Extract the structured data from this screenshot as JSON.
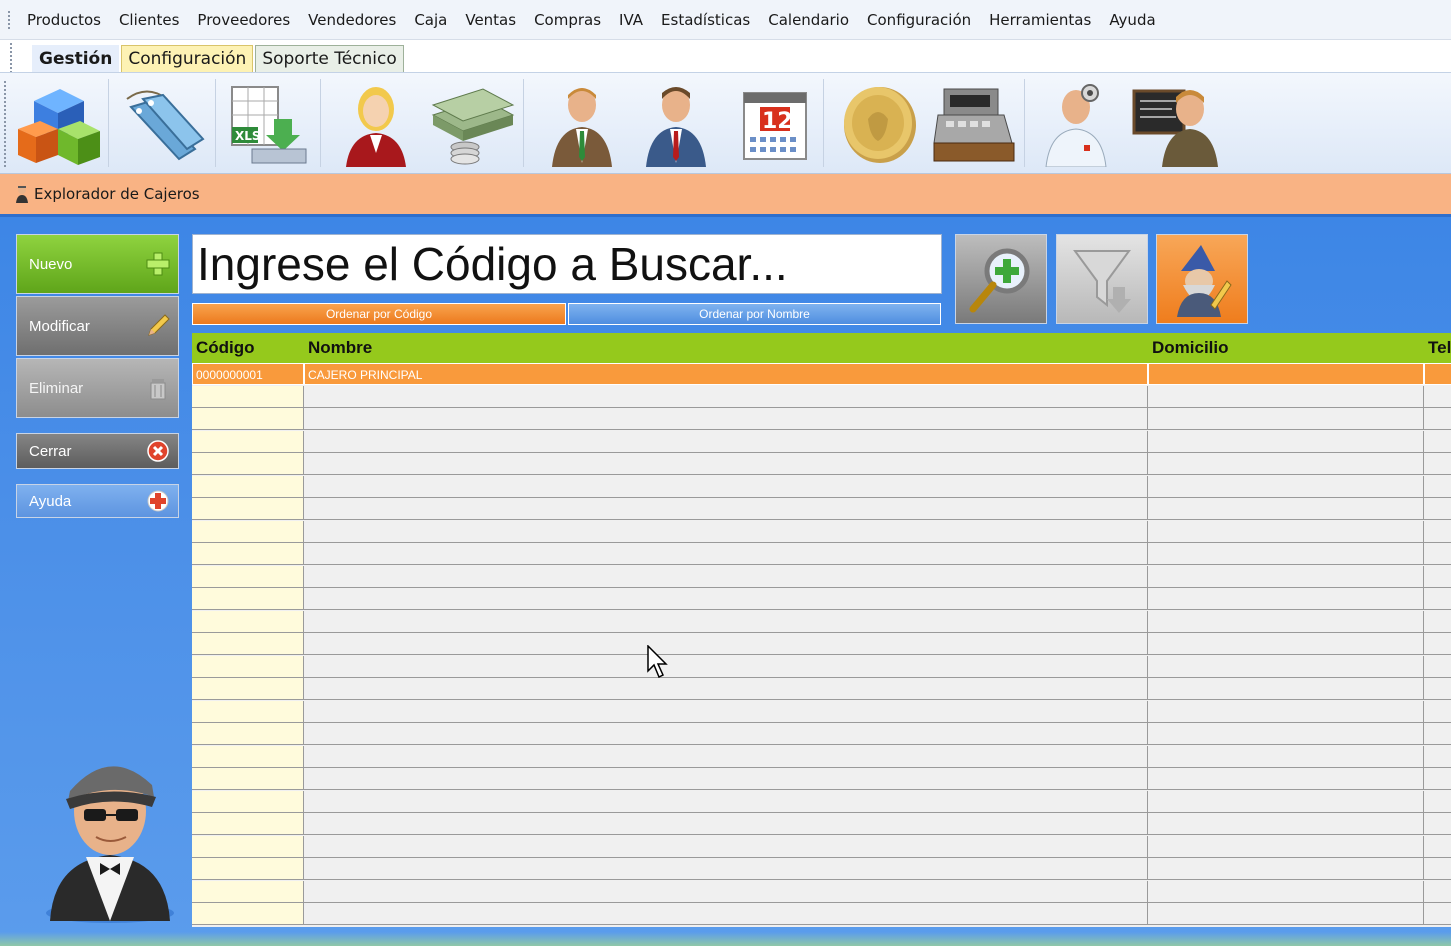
{
  "menu": {
    "items": [
      "Productos",
      "Clientes",
      "Proveedores",
      "Vendedores",
      "Caja",
      "Ventas",
      "Compras",
      "IVA",
      "Estadísticas",
      "Calendario",
      "Configuración",
      "Herramientas",
      "Ayuda"
    ]
  },
  "ribbon": {
    "tabs": [
      "Gestión",
      "Configuración",
      "Soporte Técnico"
    ],
    "active_tab": "Gestión",
    "icons": [
      "products-cubes-icon",
      "price-tags-icon",
      "xls-import-icon",
      "seller-woman-icon",
      "money-stack-icon",
      "client-man-icon",
      "supplier-man-icon",
      "calendar-12-icon",
      "coin-icon",
      "cash-register-icon",
      "doctor-support-icon",
      "teacher-blackboard-icon"
    ],
    "calendar_day": "12"
  },
  "explorer": {
    "title": "Explorador de Cajeros"
  },
  "sidebar": {
    "nuevo": "Nuevo",
    "modificar": "Modificar",
    "eliminar": "Eliminar",
    "cerrar": "Cerrar",
    "ayuda": "Ayuda"
  },
  "search": {
    "value": "Ingrese el Código a Buscar..."
  },
  "sort": {
    "by_code": "Ordenar por Código",
    "by_name": "Ordenar por Nombre",
    "active": "by_code"
  },
  "table": {
    "columns": [
      "Código",
      "Nombre",
      "Domicilio",
      "Tel"
    ],
    "rows": [
      {
        "codigo": "0000000001",
        "nombre": "CAJERO PRINCIPAL",
        "domicilio": "",
        "tel": ""
      }
    ],
    "empty_rows": 24
  },
  "colors": {
    "accent_orange": "#f99a3c",
    "header_green": "#95c91c",
    "main_blue": "#3d86e6",
    "explorer_bar": "#f9b384"
  }
}
